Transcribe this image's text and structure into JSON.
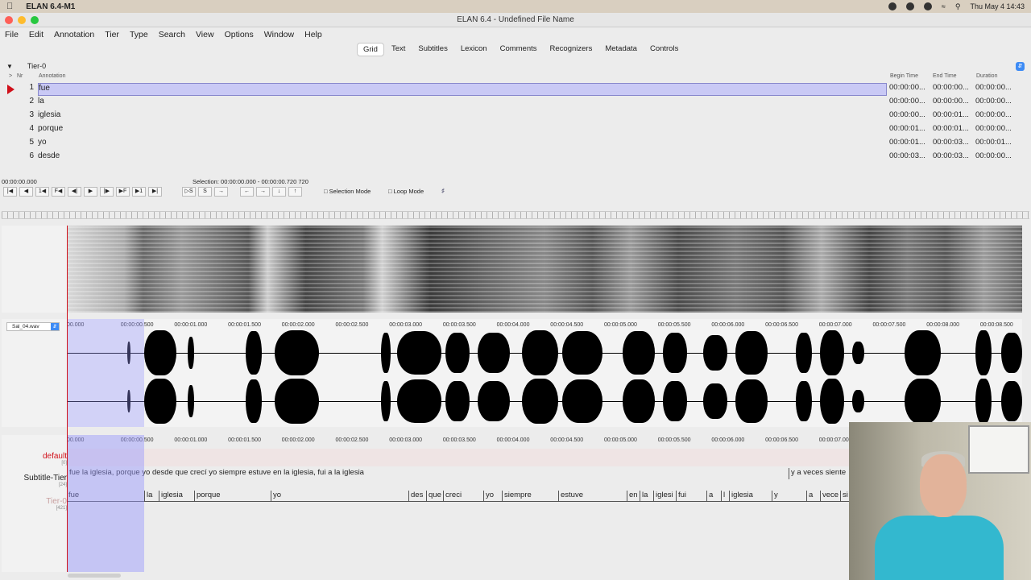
{
  "mac_menu": {
    "app_name": "ELAN 6.4-M1",
    "clock": "Thu May 4  14:43"
  },
  "window": {
    "title": "ELAN 6.4 - Undefined File Name"
  },
  "menu": [
    "File",
    "Edit",
    "Annotation",
    "Tier",
    "Type",
    "Search",
    "View",
    "Options",
    "Window",
    "Help"
  ],
  "tabs": [
    "Grid",
    "Text",
    "Subtitles",
    "Lexicon",
    "Comments",
    "Recognizers",
    "Metadata",
    "Controls"
  ],
  "grid": {
    "tier": "Tier-0",
    "columns": {
      "nr": "Nr",
      "annotation": "Annotation",
      "begin": "Begin Time",
      "end": "End Time",
      "duration": "Duration"
    },
    "rows": [
      {
        "nr": "1",
        "ann": "fue",
        "begin": "00:00:00...",
        "end": "00:00:00...",
        "dur": "00:00:00..."
      },
      {
        "nr": "2",
        "ann": "la",
        "begin": "00:00:00...",
        "end": "00:00:00...",
        "dur": "00:00:00..."
      },
      {
        "nr": "3",
        "ann": "iglesia",
        "begin": "00:00:00...",
        "end": "00:00:01...",
        "dur": "00:00:00..."
      },
      {
        "nr": "4",
        "ann": "porque",
        "begin": "00:00:01...",
        "end": "00:00:01...",
        "dur": "00:00:00..."
      },
      {
        "nr": "5",
        "ann": "yo",
        "begin": "00:00:01...",
        "end": "00:00:03...",
        "dur": "00:00:01..."
      },
      {
        "nr": "6",
        "ann": "desde",
        "begin": "00:00:03...",
        "end": "00:00:03...",
        "dur": "00:00:00..."
      }
    ]
  },
  "player": {
    "time": "00:00:00.000",
    "selection": "Selection: 00:00:00.000 - 00:00:00.720  720",
    "selection_mode": "Selection Mode",
    "loop_mode": "Loop Mode"
  },
  "media": {
    "file": "Sal_04.wav"
  },
  "wave_ruler": [
    "00.000",
    "00:00:00.500",
    "00:00:01.000",
    "00:00:01.500",
    "00:00:02.000",
    "00:00:02.500",
    "00:00:03.000",
    "00:00:03.500",
    "00:00:04.000",
    "00:00:04.500",
    "00:00:05.000",
    "00:00:05.500",
    "00:00:06.000",
    "00:00:06.500",
    "00:00:07.000",
    "00:00:07.500",
    "00:00:08.000",
    "00:00:08.500"
  ],
  "tier_ruler": [
    "00.000",
    "00:00:00.500",
    "00:00:01.000",
    "00:00:01.500",
    "00:00:02.000",
    "00:00:02.500",
    "00:00:03.000",
    "00:00:03.500",
    "00:00:04.000",
    "00:00:04.500",
    "00:00:05.000",
    "00:00:05.500",
    "00:00:06.000",
    "00:00:06.500",
    "00:00:07.000"
  ],
  "tiers": {
    "default": {
      "name": "default",
      "count": "[0]"
    },
    "subtitle": {
      "name": "Subtitle-Tier",
      "count": "[24]",
      "text": "fue la iglesia, porque yo desde que crecí yo siempre estuve en la iglesia, fui a la iglesia",
      "text2": "y a veces siente"
    },
    "tier0": {
      "name": "Tier-0",
      "count": "[421]",
      "words": [
        "fue",
        "la",
        "iglesia",
        "porque",
        "yo",
        "des",
        "que",
        "creci",
        "yo",
        "siempre",
        "estuve",
        "en",
        "la",
        "iglesi",
        "fui",
        "a",
        "l",
        "iglesia",
        "y",
        "a",
        "vece",
        "si"
      ]
    }
  }
}
